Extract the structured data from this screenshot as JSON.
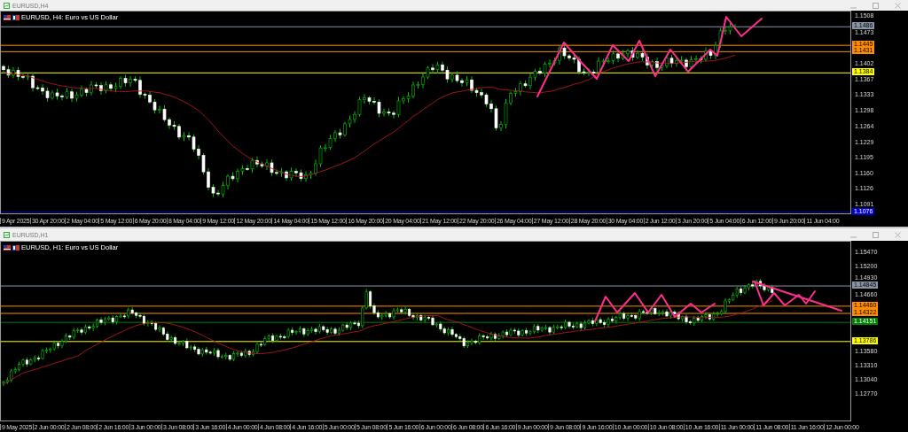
{
  "windows": [
    {
      "title": "EURUSD,H4",
      "header": "EURUSD, H4: Euro vs US Dollar",
      "price_labels": [
        "1.1508",
        "1.1473",
        "1.1402",
        "1.1367",
        "1.1333",
        "1.1298",
        "1.1264",
        "1.1229",
        "1.1195",
        "1.1160",
        "1.1126",
        "1.1091"
      ],
      "levels": [
        {
          "price": "1.1486",
          "color": "#8896a8"
        },
        {
          "price": "1.1445",
          "color": "#ff8c00"
        },
        {
          "price": "1.1431",
          "color": "#ff8c00"
        },
        {
          "price": "1.1384",
          "color": "#ffff00"
        },
        {
          "price": "1.1076",
          "color": "#0000cd"
        }
      ],
      "time_labels": [
        "9 Apr 2025",
        "30 Apr 20:00",
        "2 May 04:00",
        "5 May 12:00",
        "6 May 20:00",
        "8 May 04:00",
        "9 May 12:00",
        "12 May 20:00",
        "14 May 04:00",
        "15 May 12:00",
        "16 May 20:00",
        "20 May 04:00",
        "21 May 12:00",
        "22 May 20:00",
        "26 May 04:00",
        "27 May 12:00",
        "28 May 20:00",
        "30 May 04:00",
        "2 Jun 12:00",
        "3 Jun 20:00",
        "5 Jun 04:00",
        "6 Jun 12:00",
        "9 Jun 20:00",
        "11 Jun 04:00"
      ]
    },
    {
      "title": "EURUSD,H1",
      "header": "EURUSD, H1: Euro vs US Dollar",
      "price_labels": [
        "1.15470",
        "1.15200",
        "1.14930",
        "1.14660",
        "1.13580",
        "1.13310",
        "1.13040",
        "1.12770"
      ],
      "levels": [
        {
          "price": "1.14845",
          "color": "#8896a8"
        },
        {
          "price": "1.14460",
          "color": "#ff8c00"
        },
        {
          "price": "1.14322",
          "color": "#ff8c00"
        },
        {
          "price": "1.14151",
          "color": "#008000"
        },
        {
          "price": "1.13786",
          "color": "#ffff00"
        }
      ],
      "time_labels": [
        "9 May 2025",
        "2 Jun 00:00",
        "2 Jun 08:00",
        "2 Jun 16:00",
        "3 Jun 00:00",
        "3 Jun 08:00",
        "3 Jun 16:00",
        "4 Jun 00:00",
        "4 Jun 08:00",
        "4 Jun 16:00",
        "5 Jun 00:00",
        "5 Jun 08:00",
        "5 Jun 16:00",
        "6 Jun 00:00",
        "6 Jun 08:00",
        "6 Jun 16:00",
        "9 Jun 00:00",
        "9 Jun 08:00",
        "9 Jun 16:00",
        "10 Jun 00:00",
        "10 Jun 08:00",
        "10 Jun 16:00",
        "11 Jun 00:00",
        "11 Jun 08:00",
        "11 Jun 16:00",
        "12 Jun 00:00"
      ]
    }
  ]
}
